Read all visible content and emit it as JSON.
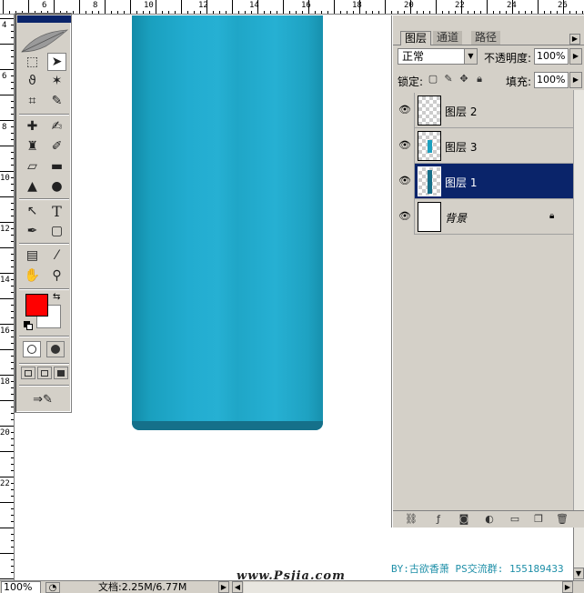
{
  "ruler_top": {
    "labels": [
      "6",
      "8",
      "10",
      "12",
      "14",
      "16",
      "18",
      "20",
      "22",
      "24",
      "26"
    ]
  },
  "ruler_left": {
    "labels": [
      "4",
      "6",
      "8",
      "10",
      "12",
      "14",
      "16",
      "18",
      "20",
      "22"
    ]
  },
  "toolbox": {
    "tools": [
      {
        "name": "marquee-tool",
        "icon": "dashed-rect-icon",
        "glyph": "⬚"
      },
      {
        "name": "move-tool",
        "icon": "move-arrow-icon",
        "glyph": "➤",
        "active": true
      },
      {
        "name": "lasso-tool",
        "icon": "lasso-icon",
        "glyph": "ϑ"
      },
      {
        "name": "magic-wand-tool",
        "icon": "magic-wand-icon",
        "glyph": "✶"
      },
      {
        "name": "crop-tool",
        "icon": "crop-icon",
        "glyph": "⌗"
      },
      {
        "name": "slice-tool",
        "icon": "slice-knife-icon",
        "glyph": "✎"
      },
      {
        "name": "healing-brush-tool",
        "icon": "bandage-icon",
        "glyph": "✚"
      },
      {
        "name": "brush-tool",
        "icon": "brush-icon",
        "glyph": "✍"
      },
      {
        "name": "clone-stamp-tool",
        "icon": "stamp-icon",
        "glyph": "♜"
      },
      {
        "name": "history-brush-tool",
        "icon": "history-brush-icon",
        "glyph": "✐"
      },
      {
        "name": "eraser-tool",
        "icon": "eraser-icon",
        "glyph": "▱"
      },
      {
        "name": "gradient-tool",
        "icon": "gradient-icon",
        "glyph": "▬"
      },
      {
        "name": "blur-tool",
        "icon": "blur-drop-icon",
        "glyph": "▲"
      },
      {
        "name": "dodge-tool",
        "icon": "dodge-icon",
        "glyph": "●"
      },
      {
        "name": "path-selection-tool",
        "icon": "arrow-icon",
        "glyph": "↖"
      },
      {
        "name": "type-tool",
        "icon": "type-t-icon",
        "glyph": "T"
      },
      {
        "name": "pen-tool",
        "icon": "pen-icon",
        "glyph": "✒"
      },
      {
        "name": "shape-tool",
        "icon": "rounded-rect-icon",
        "glyph": "▢"
      },
      {
        "name": "notes-tool",
        "icon": "note-icon",
        "glyph": "▤"
      },
      {
        "name": "eyedropper-tool",
        "icon": "eyedropper-icon",
        "glyph": "⁄"
      },
      {
        "name": "hand-tool",
        "icon": "hand-icon",
        "glyph": "✋"
      },
      {
        "name": "zoom-tool",
        "icon": "magnifier-icon",
        "glyph": "⚲"
      }
    ],
    "foreground_color": "#ff0000",
    "background_color": "#ffffff"
  },
  "layers_panel": {
    "tabs": [
      {
        "label": "图层",
        "active": true
      },
      {
        "label": "通道",
        "active": false
      },
      {
        "label": "路径",
        "active": false
      }
    ],
    "blend_mode": "正常",
    "opacity_label": "不透明度:",
    "opacity_value": "100%",
    "lock_label": "锁定:",
    "fill_label": "填充:",
    "fill_value": "100%",
    "layers": [
      {
        "name": "图层 2",
        "visible": true,
        "selected": false,
        "thumb": "transparent"
      },
      {
        "name": "图层 3",
        "visible": true,
        "selected": false,
        "thumb": "bar"
      },
      {
        "name": "图层 1",
        "visible": true,
        "selected": true,
        "thumb": "bar"
      },
      {
        "name": "背景",
        "visible": true,
        "selected": false,
        "thumb": "white",
        "locked": true
      }
    ]
  },
  "watermark": {
    "credit": "BY:古欲香萧 PS交流群: 155189433",
    "site": "www.Psjia.com"
  },
  "status_bar": {
    "zoom": "100%",
    "doc_info": "文档:2.25M/6.77M"
  },
  "colors": {
    "bottle": "#1fa6c7",
    "selection": "#0a246a",
    "panel_bg": "#d4d0c8"
  }
}
